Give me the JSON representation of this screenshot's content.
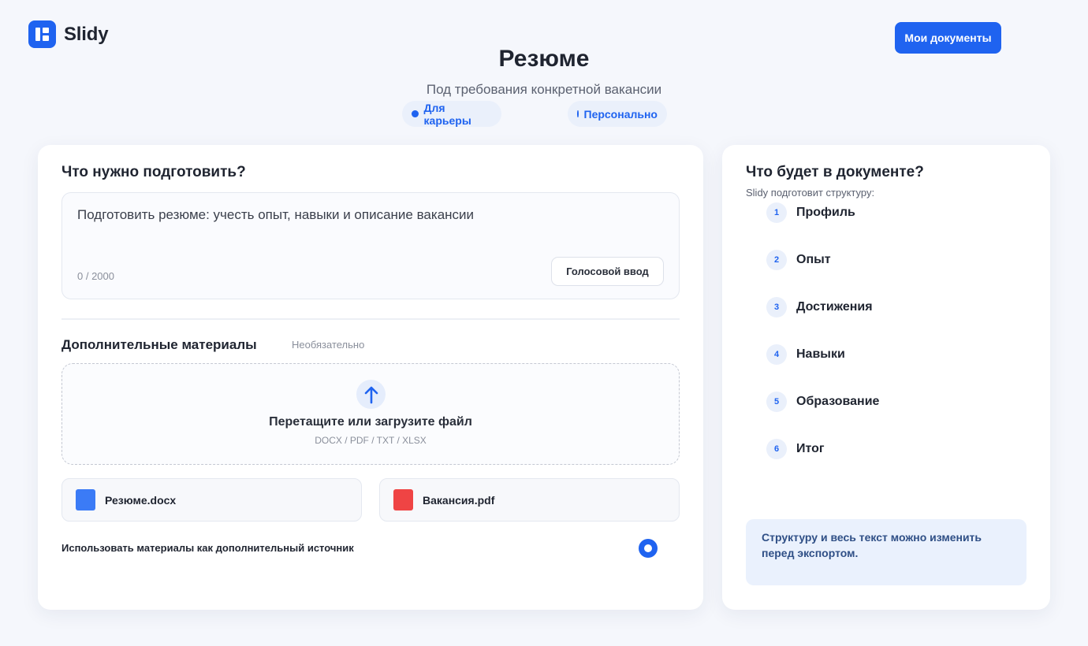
{
  "app": {
    "name": "Slidy"
  },
  "header": {
    "my_docs_label": "Мои документы"
  },
  "page": {
    "title": "Резюме",
    "subtitle": "Под требования конкретной вакансии",
    "chips": [
      {
        "label": "Для карьеры"
      },
      {
        "label": "Персонально"
      }
    ]
  },
  "prompt": {
    "title": "Что нужно подготовить?",
    "text": "Подготовить резюме: учесть опыт, навыки и описание вакансии",
    "counter": "0 / 2000",
    "voice_label": "Голосовой ввод"
  },
  "materials": {
    "title": "Дополнительные материалы",
    "optional": "Необязательно",
    "drop_title": "Перетащите или загрузите файл",
    "drop_formats": "DOCX / PDF / TXT / XLSX",
    "files": [
      {
        "name": "Резюме.docx",
        "color": "#3b7bf6"
      },
      {
        "name": "Вакансия.pdf",
        "color": "#ef4444"
      }
    ],
    "use_as_source_label": "Использовать материалы как дополнительный источник",
    "use_as_source_checked": true
  },
  "structure": {
    "title": "Что будет в документе?",
    "subtitle": "Slidy подготовит структуру:",
    "items": [
      {
        "num": "1",
        "label": "Профиль"
      },
      {
        "num": "2",
        "label": "Опыт"
      },
      {
        "num": "3",
        "label": "Достижения"
      },
      {
        "num": "4",
        "label": "Навыки"
      },
      {
        "num": "5",
        "label": "Образование"
      },
      {
        "num": "6",
        "label": "Итог"
      }
    ],
    "note": "Структуру и весь текст можно изменить перед экспортом."
  },
  "colors": {
    "accent": "#1f63f0",
    "background": "#f5f7fc"
  }
}
